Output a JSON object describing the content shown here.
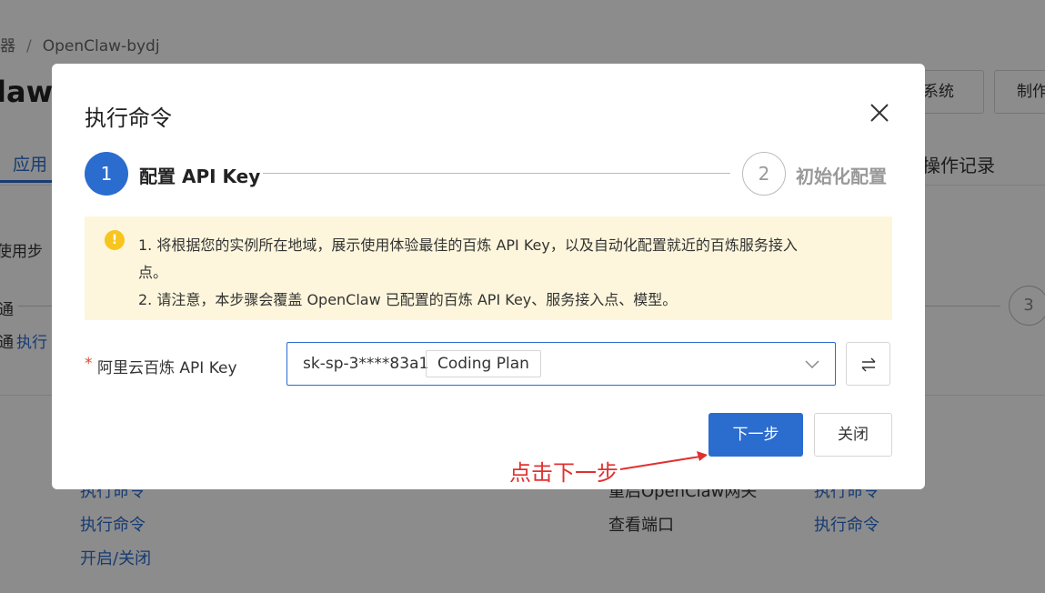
{
  "background": {
    "breadcrumb": {
      "first": "器",
      "separator": "/",
      "current": "OpenClaw-bydj"
    },
    "page_title": "law-",
    "header_buttons": [
      {
        "label": "系统"
      },
      {
        "label": "制作"
      }
    ],
    "tabs": {
      "app": "应用",
      "op_log": "操作记录"
    },
    "usage_steps": "使用步",
    "step_fragment_1": "通",
    "step_fragment_2": "通",
    "exec_fragment": "执行",
    "step3_number": "3",
    "table": {
      "left_links": [
        "执行命令",
        "执行命令",
        "开启/关闭"
      ],
      "middle": [
        "重启OpenClaw网关",
        "查看端口"
      ],
      "right_links": [
        "执行命令",
        "执行命令"
      ]
    }
  },
  "modal": {
    "title": "执行命令",
    "steps": [
      {
        "number": "1",
        "label": "配置 API Key"
      },
      {
        "number": "2",
        "label": "初始化配置"
      }
    ],
    "notice": {
      "icon": "!",
      "lines": [
        "1. 将根据您的实例所在地域，展示使用体验最佳的百炼 API Key，以及自动化配置就近的百炼服务接入",
        "点。",
        "2. 请注意，本步骤会覆盖 OpenClaw 已配置的百炼 API Key、服务接入点、模型。"
      ]
    },
    "field": {
      "required_mark": "*",
      "label": "阿里云百炼 API Key",
      "value": "sk-sp-3****83a1",
      "tag": "Coding Plan"
    },
    "buttons": {
      "next": "下一步",
      "close": "关闭"
    }
  },
  "annotation": {
    "text": "点击下一步",
    "color": "#e03131"
  },
  "colors": {
    "primary": "#2b6ccf",
    "warning_bg": "#fdf6dc",
    "warning_icon": "#f7c51d",
    "required": "#e0452e"
  }
}
